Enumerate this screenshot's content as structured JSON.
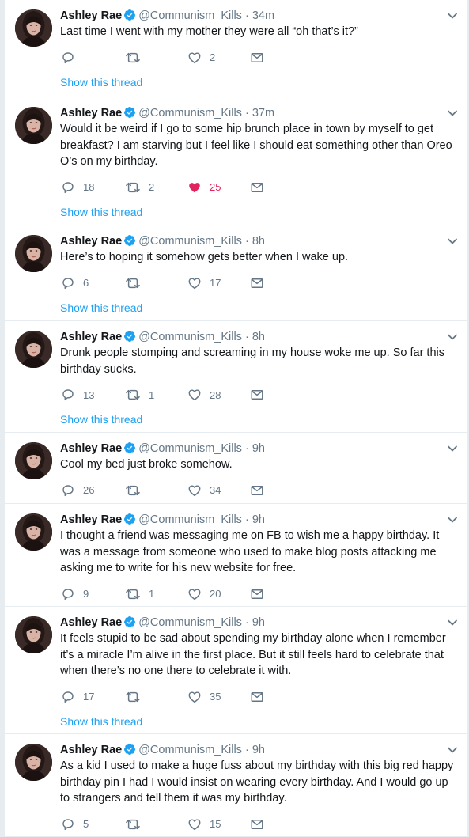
{
  "author": {
    "name": "Ashley Rae",
    "handle": "@Communism_Kills",
    "verified": true
  },
  "icons": {
    "reply": "reply-icon",
    "retweet": "retweet-icon",
    "like": "heart-icon",
    "dm": "envelope-icon",
    "menu": "chevron-down-icon",
    "verified": "verified-badge-icon"
  },
  "colors": {
    "accent": "#1da1f2",
    "like_active": "#e0245e",
    "muted": "#657786"
  },
  "show_thread_label": "Show this thread",
  "tweets": [
    {
      "time": "34m",
      "text": "Last time I went with my mother they were all “oh that’s it?”",
      "replies": "",
      "retweets": "",
      "likes": "2",
      "liked": false,
      "show_thread": true
    },
    {
      "time": "37m",
      "text": "Would it be weird if I go to some hip brunch place in town by myself to get breakfast? I am starving but I feel like I should eat something other than Oreo O’s on my birthday.",
      "replies": "18",
      "retweets": "2",
      "likes": "25",
      "liked": true,
      "show_thread": true
    },
    {
      "time": "8h",
      "text": "Here’s to hoping it somehow gets better when I wake up.",
      "replies": "6",
      "retweets": "",
      "likes": "17",
      "liked": false,
      "show_thread": true
    },
    {
      "time": "8h",
      "text": "Drunk people stomping and screaming in my house woke me up. So far this birthday sucks.",
      "replies": "13",
      "retweets": "1",
      "likes": "28",
      "liked": false,
      "show_thread": true
    },
    {
      "time": "9h",
      "text": "Cool my bed just broke somehow.",
      "replies": "26",
      "retweets": "",
      "likes": "34",
      "liked": false,
      "show_thread": false
    },
    {
      "time": "9h",
      "text": "I thought a friend was messaging me on FB to wish me a happy birthday. It was a message from someone who used to make blog posts attacking me asking me to write for his new website for free.",
      "replies": "9",
      "retweets": "1",
      "likes": "20",
      "liked": false,
      "show_thread": false
    },
    {
      "time": "9h",
      "text": "It feels stupid to be sad about spending my birthday alone when I remember it’s a miracle I’m alive in the first place. But it still feels hard to celebrate that when there’s no one there to celebrate it with.",
      "replies": "17",
      "retweets": "",
      "likes": "35",
      "liked": false,
      "show_thread": true
    },
    {
      "time": "9h",
      "text": "As a kid I used to make a huge fuss about my birthday with this big red happy birthday pin I had I would insist on wearing every birthday. And I would go up to strangers and tell them it was my birthday.",
      "replies": "5",
      "retweets": "",
      "likes": "15",
      "liked": false,
      "show_thread": false
    }
  ]
}
